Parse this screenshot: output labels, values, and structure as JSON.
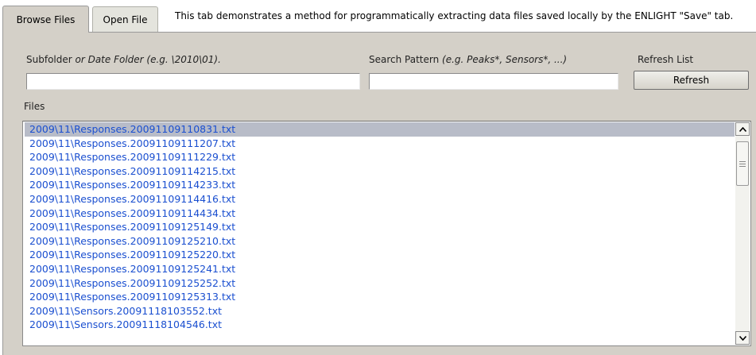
{
  "tabs": [
    {
      "label": "Browse Files"
    },
    {
      "label": "Open File"
    }
  ],
  "tab_description": "This tab demonstrates a method for programmatically extracting data files saved locally by the ENLIGHT \"Save\" tab.",
  "subfolder": {
    "label_plain": "Subfolder ",
    "label_italic": "or Date Folder (e.g. \\2010\\01).",
    "value": ""
  },
  "search": {
    "label_plain": "Search Pattern ",
    "label_italic": "(e.g. Peaks*, Sensors*, ...)",
    "value": ""
  },
  "refresh": {
    "label": "Refresh List",
    "button_label": "Refresh"
  },
  "files": {
    "label": "Files",
    "selected_index": 0,
    "items": [
      "2009\\11\\Responses.20091109110831.txt",
      "2009\\11\\Responses.20091109111207.txt",
      "2009\\11\\Responses.20091109111229.txt",
      "2009\\11\\Responses.20091109114215.txt",
      "2009\\11\\Responses.20091109114233.txt",
      "2009\\11\\Responses.20091109114416.txt",
      "2009\\11\\Responses.20091109114434.txt",
      "2009\\11\\Responses.20091109125149.txt",
      "2009\\11\\Responses.20091109125210.txt",
      "2009\\11\\Responses.20091109125220.txt",
      "2009\\11\\Responses.20091109125241.txt",
      "2009\\11\\Responses.20091109125252.txt",
      "2009\\11\\Responses.20091109125313.txt",
      "2009\\11\\Sensors.20091118103552.txt",
      "2009\\11\\Sensors.20091118104546.txt"
    ]
  },
  "icons": {
    "scroll_up": "chevron-up-icon",
    "scroll_down": "chevron-down-icon",
    "scroll_grip": "grip-icon"
  }
}
